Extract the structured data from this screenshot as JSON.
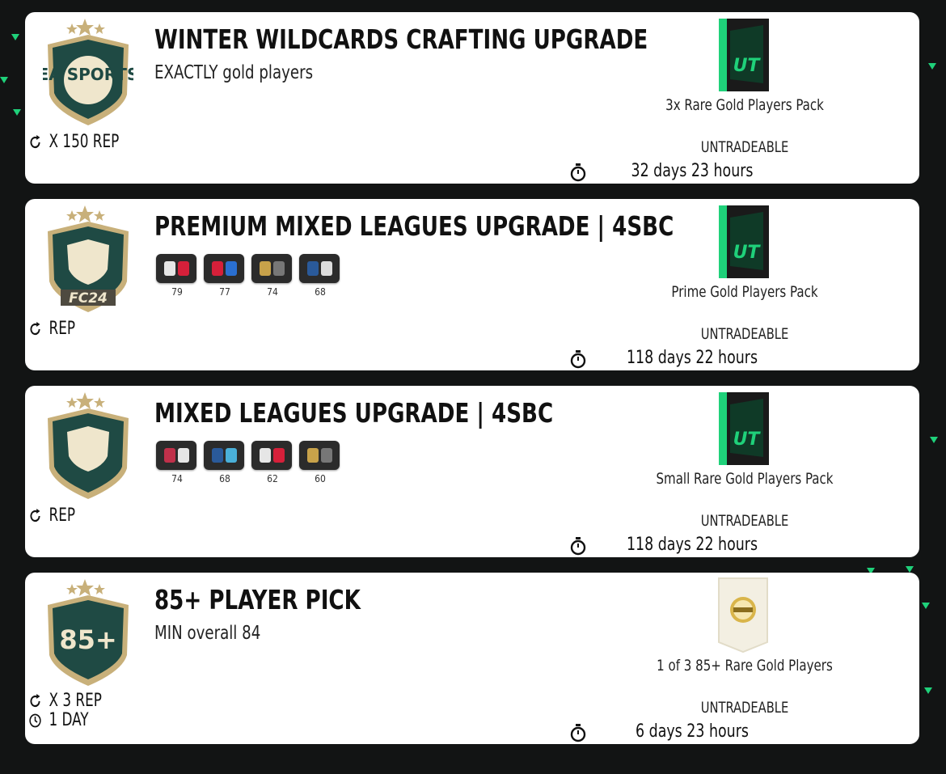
{
  "colors": {
    "background": "#121414",
    "card": "#ffffff",
    "pack_green": "#1fd17a",
    "badge_gold": "#c8b07a",
    "badge_green": "#1f4a44"
  },
  "challenges": [
    {
      "title": "WINTER WILDCARDS CRAFTING UPGRADE",
      "subtitle": "EXACTLY gold players",
      "badge_text": "EA SPORTS",
      "badge_icon": "ea-sports-badge",
      "repeat_label": "X 150 REP",
      "reward_name": "3x Rare Gold Players Pack",
      "reward_icon": "ut-pack-icon",
      "pack_text": "UT",
      "tradeable": "UNTRADEABLE",
      "time_left": "32 days 23 hours"
    },
    {
      "title": "PREMIUM MIXED LEAGUES UPGRADE | 4SBC",
      "badge_text": "FC24",
      "badge_icon": "fc24-badge",
      "leagues": [
        {
          "rating": "79"
        },
        {
          "rating": "77"
        },
        {
          "rating": "74"
        },
        {
          "rating": "68"
        }
      ],
      "repeat_label": "REP",
      "reward_name": "Prime Gold Players Pack",
      "reward_icon": "ut-pack-icon",
      "pack_text": "UT",
      "tradeable": "UNTRADEABLE",
      "time_left": "118 days 22 hours"
    },
    {
      "title": "MIXED LEAGUES UPGRADE | 4SBC",
      "badge_icon": "crest-badge",
      "leagues": [
        {
          "rating": "74"
        },
        {
          "rating": "68"
        },
        {
          "rating": "62"
        },
        {
          "rating": "60"
        }
      ],
      "repeat_label": "REP",
      "reward_name": "Small Rare Gold Players Pack",
      "reward_icon": "ut-pack-icon",
      "pack_text": "UT",
      "tradeable": "UNTRADEABLE",
      "time_left": "118 days 22 hours"
    },
    {
      "title": "85+ PLAYER PICK",
      "subtitle": "MIN overall 84",
      "badge_text": "85+",
      "badge_icon": "85-plus-badge",
      "repeat_label": "X 3 REP",
      "refresh_label": "1 DAY",
      "reward_name": "1 of 3 85+ Rare Gold Players",
      "reward_icon": "player-pick-icon",
      "tradeable": "UNTRADEABLE",
      "time_left": "6 days 23 hours"
    }
  ]
}
